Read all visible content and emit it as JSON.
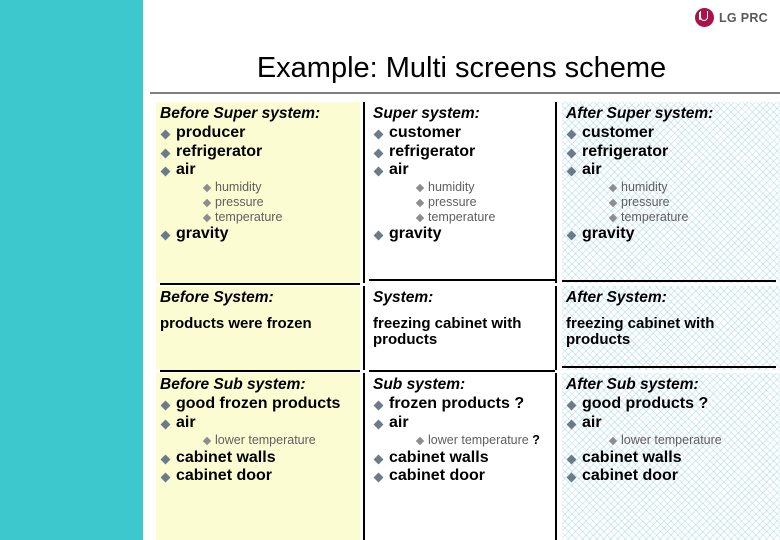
{
  "slide": {
    "title": "Example: Multi screens scheme",
    "sidebar_color": "#3cc8cd",
    "rule_color": "#808080"
  },
  "logo": {
    "mark_name": "lg-circle-logo",
    "wordmark": "LG PRC",
    "color": "#a8134a"
  },
  "palette": {
    "before_cell_bg": "#fcfcd2",
    "now_cell_bg": "#ffffff",
    "after_cell_bg_hatch": "#78bedc",
    "bullet_level1": "#6b7b8c",
    "bullet_level2": "#8d8d8d",
    "text": "#000000",
    "subtext": "#5f5f5f"
  },
  "matrix": {
    "rows": [
      {
        "id": "super-system",
        "cells": [
          {
            "id": "before-super-system",
            "heading": "Before Super system:",
            "items": [
              {
                "label": "producer"
              },
              {
                "label": "refrigerator"
              },
              {
                "label": "air",
                "children": [
                  "humidity",
                  "pressure",
                  "temperature"
                ]
              },
              {
                "label": "gravity"
              }
            ]
          },
          {
            "id": "super-system",
            "heading": "Super system:",
            "items": [
              {
                "label": "customer"
              },
              {
                "label": "refrigerator"
              },
              {
                "label": "air",
                "children": [
                  "humidity",
                  "pressure",
                  "temperature"
                ]
              },
              {
                "label": "gravity"
              }
            ]
          },
          {
            "id": "after-super-system",
            "heading": "After Super system:",
            "items": [
              {
                "label": "customer"
              },
              {
                "label": "refrigerator"
              },
              {
                "label": "air",
                "children": [
                  "humidity",
                  "pressure",
                  "temperature"
                ]
              },
              {
                "label": "gravity"
              }
            ]
          }
        ]
      },
      {
        "id": "system",
        "cells": [
          {
            "id": "before-system",
            "heading": "Before System:",
            "body": "products were frozen"
          },
          {
            "id": "system",
            "heading": "System:",
            "body": "freezing cabinet with products"
          },
          {
            "id": "after-system",
            "heading": "After System:",
            "body": "freezing cabinet with products"
          }
        ]
      },
      {
        "id": "sub-system",
        "cells": [
          {
            "id": "before-sub-system",
            "heading": "Before Sub system:",
            "items": [
              {
                "label": "good frozen products",
                "wrap": true
              },
              {
                "label": "air",
                "children": [
                  "lower temperature"
                ]
              },
              {
                "label": "cabinet walls"
              },
              {
                "label": "cabinet door"
              }
            ]
          },
          {
            "id": "sub-system",
            "heading": "Sub system:",
            "items": [
              {
                "label": "frozen products ?"
              },
              {
                "label": "air",
                "children": [
                  "lower temperature ?"
                ]
              },
              {
                "label": "cabinet walls"
              },
              {
                "label": "cabinet door"
              }
            ]
          },
          {
            "id": "after-sub-system",
            "heading": "After Sub system:",
            "items": [
              {
                "label": "good products ?"
              },
              {
                "label": "air",
                "children": [
                  "lower temperature"
                ]
              },
              {
                "label": "cabinet walls"
              },
              {
                "label": "cabinet door"
              }
            ]
          }
        ]
      }
    ]
  }
}
